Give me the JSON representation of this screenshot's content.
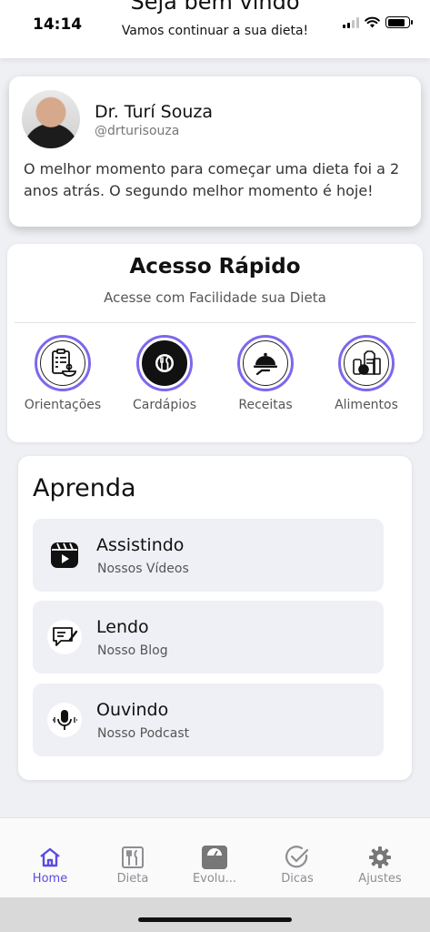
{
  "status_bar": {
    "time": "14:14"
  },
  "header": {
    "title": "Seja bem vindo",
    "subtitle": "Vamos continuar a sua dieta!"
  },
  "profile": {
    "name": "Dr. Turí Souza",
    "handle": "@drturisouza",
    "quote": "O melhor momento para começar uma dieta foi a 2 anos atrás. O segundo melhor momento é hoje!"
  },
  "quick_access": {
    "title": "Acesso Rápido",
    "subtitle": "Acesse com Facilidade sua Dieta",
    "items": [
      {
        "label": "Orientações",
        "icon": "guidelines-icon"
      },
      {
        "label": "Cardápios",
        "icon": "plate-cutlery-icon"
      },
      {
        "label": "Receitas",
        "icon": "cloche-icon"
      },
      {
        "label": "Alimentos",
        "icon": "groceries-icon"
      }
    ]
  },
  "learn": {
    "title": "Aprenda",
    "items": [
      {
        "title": "Assistindo",
        "subtitle": "Nossos Vídeos",
        "icon": "video-icon"
      },
      {
        "title": "Lendo",
        "subtitle": "Nosso Blog",
        "icon": "blog-icon"
      },
      {
        "title": "Ouvindo",
        "subtitle": "Nosso Podcast",
        "icon": "microphone-icon"
      }
    ]
  },
  "tab_bar": {
    "active": "Home",
    "tabs": [
      {
        "label": "Home",
        "icon": "home-icon"
      },
      {
        "label": "Dieta",
        "icon": "diet-icon"
      },
      {
        "label": "Evolu...",
        "icon": "scale-icon"
      },
      {
        "label": "Dicas",
        "icon": "check-circle-icon"
      },
      {
        "label": "Ajustes",
        "icon": "gear-icon"
      }
    ]
  },
  "colors": {
    "accent": "#5b4be0",
    "ring": "#7b68ee",
    "background": "#eef0f4",
    "item_background": "#eef0f5"
  }
}
